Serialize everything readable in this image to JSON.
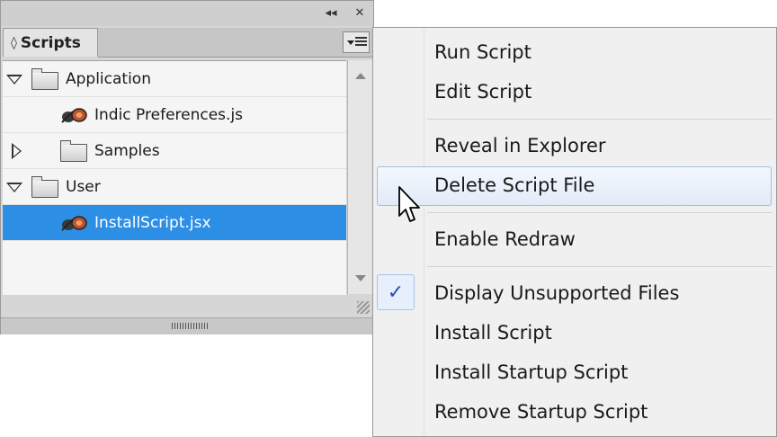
{
  "panel": {
    "tab_title": "Scripts",
    "tab_caret": "◊",
    "collapse_glyph": "◂◂",
    "close_glyph": "✕",
    "tree": [
      {
        "label": "Application",
        "type": "folder",
        "level": 0,
        "expanded": true
      },
      {
        "label": "Indic Preferences.js",
        "type": "script",
        "level": 1
      },
      {
        "label": "Samples",
        "type": "folder",
        "level": 1,
        "expanded": false
      },
      {
        "label": "User",
        "type": "folder",
        "level": 0,
        "expanded": true
      },
      {
        "label": "InstallScript.jsx",
        "type": "script",
        "level": 1,
        "selected": true
      }
    ]
  },
  "menu": {
    "items": [
      {
        "label": "Run Script"
      },
      {
        "label": "Edit Script"
      },
      {
        "label": "Reveal in Explorer"
      },
      {
        "label": "Delete Script File",
        "hovered": true
      },
      {
        "label": "Enable Redraw"
      },
      {
        "label": "Display Unsupported Files",
        "checked": true
      },
      {
        "label": "Install Script"
      },
      {
        "label": "Install Startup Script"
      },
      {
        "label": "Remove Startup Script"
      }
    ],
    "check_glyph": "✓"
  },
  "colors": {
    "selection": "#2d8ee6",
    "menu_hover_border": "#9fc0e6",
    "check": "#2a4db3"
  }
}
